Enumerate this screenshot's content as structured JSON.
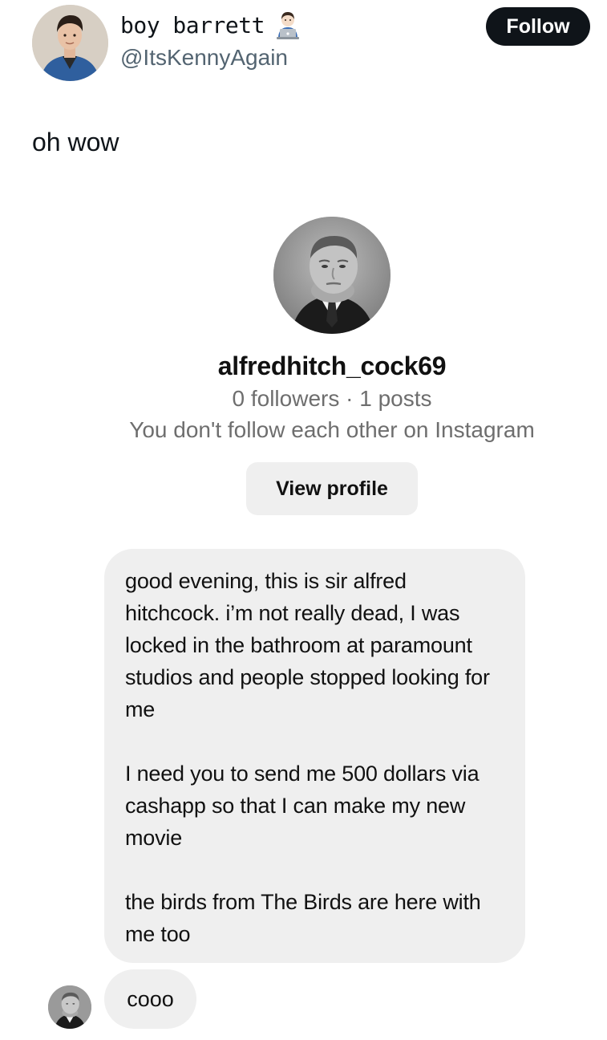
{
  "tweet": {
    "author": {
      "display_name": "boy barrett",
      "name_emoji": "technologist-emoji",
      "handle": "@ItsKennyAgain"
    },
    "follow_label": "Follow",
    "text": "oh wow"
  },
  "instagram": {
    "username": "alfredhitch_cock69",
    "stats": "0 followers · 1 posts",
    "relationship": "You don't follow each other on Instagram",
    "view_profile_label": "View profile",
    "messages": [
      {
        "paragraphs": [
          "good evening, this is sir alfred hitchcock. i’m not really dead, I was locked in the bathroom at paramount studios and people stopped looking for me",
          "I need you to send me 500 dollars via cashapp so that I can make my new movie",
          "the birds from The Birds are here with me too"
        ]
      },
      {
        "text": "cooo"
      }
    ]
  },
  "colors": {
    "follow_bg": "#0f1419",
    "handle_text": "#536471",
    "bubble_bg": "#efefef",
    "secondary_text": "#6e6e6e"
  }
}
